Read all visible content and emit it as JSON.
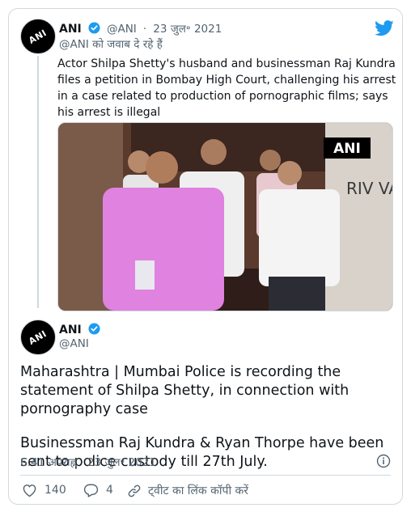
{
  "quoted_tweet": {
    "author_name": "ANI",
    "handle": "@ANI",
    "separator": "·",
    "date": "23 जुल॰ 2021",
    "reply_context": "@ANI को जवाब दे रहे हैं",
    "text": "Actor Shilpa Shetty's husband and businessman Raj Kundra files a petition in Bombay High Court, challenging his arrest in a case related to production of pornographic films; says his arrest is illegal",
    "media_watermark": "ANI",
    "media_wall_text": "RIV VAN"
  },
  "main_tweet": {
    "author_name": "ANI",
    "handle": "@ANI",
    "paragraphs": [
      "Maharashtra | Mumbai Police is recording the statement of Shilpa Shetty, in connection with pornography case",
      "Businessman Raj Kundra & Ryan Thorpe have been sent to police custody till 27th July."
    ],
    "timestamp": "6:41 अपराह्न · 23 जुल॰ 2021"
  },
  "actions": {
    "likes": "140",
    "replies": "4",
    "copy_link": "ट्वीट का लिंक कॉपी करें"
  },
  "avatar_text": "ANI",
  "colors": {
    "brand_blue": "#1d9bf0",
    "muted": "#536471",
    "border": "#cfd9de",
    "text": "#0f1419"
  },
  "icons": [
    "twitter-bird-icon",
    "verified-badge-icon",
    "info-icon",
    "heart-icon",
    "reply-icon",
    "link-icon"
  ]
}
